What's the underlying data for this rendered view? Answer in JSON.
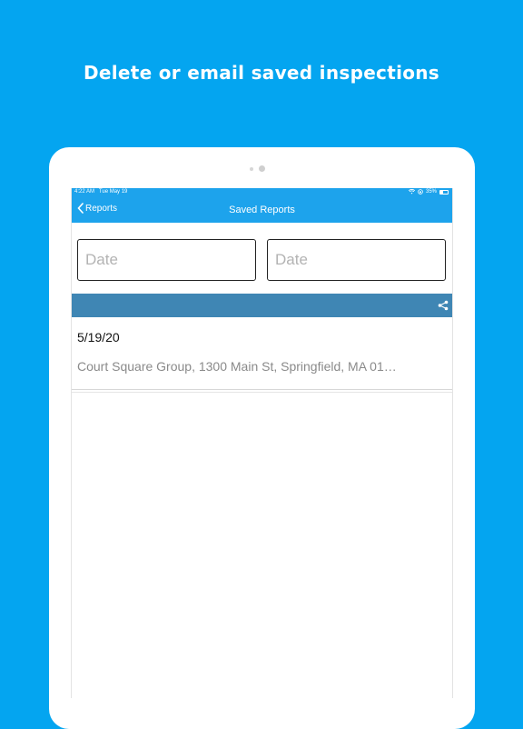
{
  "headline": "Delete or email saved inspections",
  "status": {
    "time": "4:22 AM",
    "date": "Tue May 19",
    "battery": "35%"
  },
  "nav": {
    "back_label": "Reports",
    "title": "Saved Reports"
  },
  "filters": {
    "date_from_placeholder": "Date",
    "date_to_placeholder": "Date"
  },
  "reports": [
    {
      "date": "5/19/20",
      "address": "Court Square Group, 1300 Main St, Springfield, MA  01…"
    }
  ],
  "colors": {
    "background": "#04a5f0",
    "navbar": "#1da3ec",
    "section_bar": "#3f86b4"
  },
  "icons": {
    "back": "chevron-left-icon",
    "share": "share-icon",
    "wifi": "wifi-icon",
    "battery": "battery-icon"
  }
}
